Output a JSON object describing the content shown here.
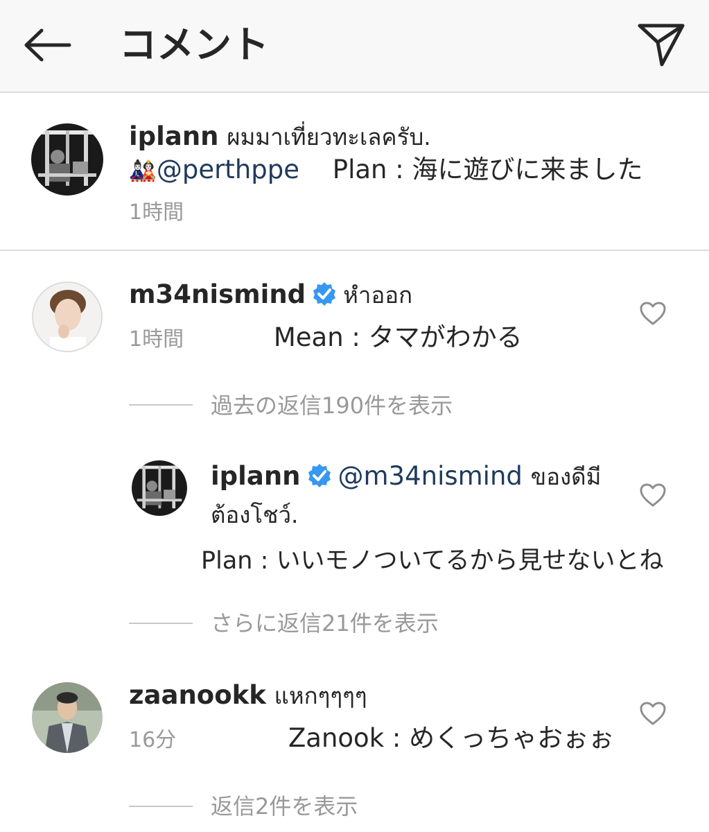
{
  "header": {
    "title": "コメント"
  },
  "caption": {
    "username": "iplann",
    "text": "ผมมาเที่ยวทะเลครับ.",
    "mention_icon": "🎎",
    "mention": "@perthppe",
    "translation": "Plan : 海に遊びに来ました",
    "time": "1時間"
  },
  "comments": [
    {
      "username": "m34nismind",
      "verified": true,
      "text": "หำออก",
      "time": "1時間",
      "translation": "Mean : タマがわかる",
      "view_replies": "過去の返信190件を表示"
    },
    {
      "username": "iplann",
      "verified": true,
      "mention": "@m34nismind",
      "text_line1": "ของดีมี",
      "text_line2": "ต้องโชว์.",
      "translation": "Plan : いいモノついてるから見せないとね",
      "view_replies": "さらに返信21件を表示"
    },
    {
      "username": "zaanookk",
      "text": "แหกๆๆๆๆ",
      "time": "16分",
      "translation": "Zanook : めくっちゃおぉぉ",
      "view_replies": "返信2件を表示"
    }
  ],
  "colors": {
    "verified": "#3897f0",
    "muted": "#999999",
    "mention": "#1f3a5c"
  },
  "icons": [
    "back-arrow-icon",
    "send-icon",
    "heart-icon",
    "verified-badge-icon"
  ]
}
